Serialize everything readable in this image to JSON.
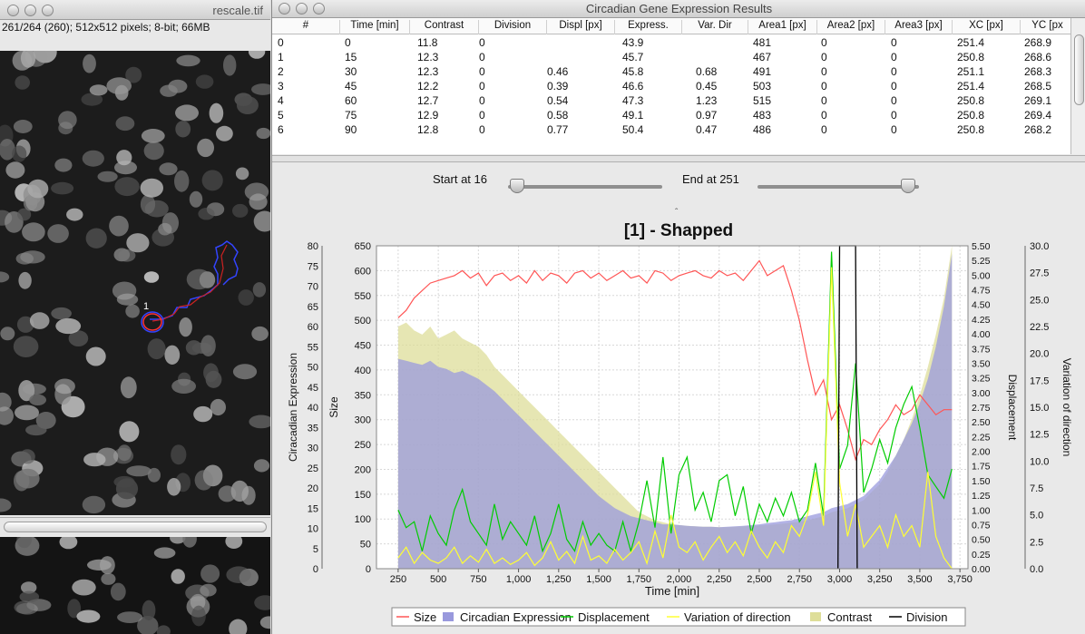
{
  "image_window": {
    "title": "rescale.tif",
    "info": "261/264 (260); 512x512 pixels; 8-bit; 66MB",
    "roi_label": "1"
  },
  "results_window": {
    "title": "Circadian Gene Expression Results"
  },
  "table": {
    "columns": [
      "#",
      "Time [min]",
      "Contrast",
      "Division",
      "Displ [px]",
      "Express.",
      "Var. Dir",
      "Area1 [px]",
      "Area2 [px]",
      "Area3 [px]",
      "XC [px]",
      "YC [px"
    ],
    "rows": [
      [
        "0",
        "0",
        "11.8",
        "0",
        "",
        "43.9",
        "",
        "481",
        "0",
        "0",
        "251.4",
        "268.9"
      ],
      [
        "1",
        "15",
        "12.3",
        "0",
        "",
        "45.7",
        "",
        "467",
        "0",
        "0",
        "250.8",
        "268.6"
      ],
      [
        "2",
        "30",
        "12.3",
        "0",
        "0.46",
        "45.8",
        "0.68",
        "491",
        "0",
        "0",
        "251.1",
        "268.3"
      ],
      [
        "3",
        "45",
        "12.2",
        "0",
        "0.39",
        "46.6",
        "0.45",
        "503",
        "0",
        "0",
        "251.4",
        "268.5"
      ],
      [
        "4",
        "60",
        "12.7",
        "0",
        "0.54",
        "47.3",
        "1.23",
        "515",
        "0",
        "0",
        "250.8",
        "269.1"
      ],
      [
        "5",
        "75",
        "12.9",
        "0",
        "0.58",
        "49.1",
        "0.97",
        "483",
        "0",
        "0",
        "250.8",
        "269.4"
      ],
      [
        "6",
        "90",
        "12.8",
        "0",
        "0.77",
        "50.4",
        "0.47",
        "486",
        "0",
        "0",
        "250.8",
        "268.2"
      ]
    ]
  },
  "controls": {
    "start_label": "Start at 16",
    "end_label": "End at 251",
    "start_slider_value": 0.06,
    "end_slider_value": 0.93
  },
  "chart_data": {
    "type": "line",
    "title": "[1] - Shapped",
    "xlabel": "Time [min]",
    "xlim": [
      115,
      3800
    ],
    "x_ticks": [
      "250",
      "500",
      "750",
      "1,000",
      "1,250",
      "1,500",
      "1,750",
      "2,000",
      "2,250",
      "2,500",
      "2,750",
      "3,000",
      "3,250",
      "3,500",
      "3,750"
    ],
    "x_tick_values": [
      250,
      500,
      750,
      1000,
      1250,
      1500,
      1750,
      2000,
      2250,
      2500,
      2750,
      3000,
      3250,
      3500,
      3750
    ],
    "axes": {
      "circadian": {
        "label": "Ciracadian Expression",
        "ylim": [
          0,
          80
        ],
        "ticks": [
          "0",
          "5",
          "10",
          "15",
          "20",
          "25",
          "30",
          "35",
          "40",
          "45",
          "50",
          "55",
          "60",
          "65",
          "70",
          "75",
          "80"
        ]
      },
      "size": {
        "label": "Size",
        "ylim": [
          0,
          650
        ],
        "ticks": [
          "0",
          "50",
          "100",
          "150",
          "200",
          "250",
          "300",
          "350",
          "400",
          "450",
          "500",
          "550",
          "600",
          "650"
        ]
      },
      "displacement": {
        "label": "Displacement",
        "ylim": [
          0,
          5.5
        ],
        "ticks": [
          "0.00",
          "0.25",
          "0.50",
          "0.75",
          "1.00",
          "1.25",
          "1.50",
          "1.75",
          "2.00",
          "2.25",
          "2.50",
          "2.75",
          "3.00",
          "3.25",
          "3.50",
          "3.75",
          "4.00",
          "4.25",
          "4.50",
          "4.75",
          "5.00",
          "5.25",
          "5.50"
        ]
      },
      "variation": {
        "label": "Variation of direction",
        "ylim": [
          0,
          30
        ],
        "ticks": [
          "0.0",
          "2.5",
          "5.0",
          "7.5",
          "10.0",
          "12.5",
          "15.0",
          "17.5",
          "20.0",
          "22.5",
          "25.0",
          "27.5",
          "30.0"
        ]
      }
    },
    "legend_position": "bottom",
    "series": [
      {
        "name": "Size",
        "color": "#ff5555",
        "axis": "size",
        "x": [
          250,
          300,
          350,
          400,
          450,
          500,
          550,
          600,
          650,
          700,
          750,
          800,
          850,
          900,
          950,
          1000,
          1050,
          1100,
          1150,
          1200,
          1250,
          1300,
          1350,
          1400,
          1450,
          1500,
          1550,
          1600,
          1650,
          1700,
          1750,
          1800,
          1850,
          1900,
          1950,
          2000,
          2050,
          2100,
          2150,
          2200,
          2250,
          2300,
          2350,
          2400,
          2450,
          2500,
          2550,
          2600,
          2650,
          2700,
          2750,
          2800,
          2850,
          2900,
          2950,
          3000,
          3050,
          3100,
          3150,
          3200,
          3250,
          3300,
          3350,
          3400,
          3450,
          3500,
          3550,
          3600,
          3650,
          3700
        ],
        "values": [
          505,
          520,
          545,
          560,
          575,
          580,
          585,
          590,
          600,
          585,
          595,
          570,
          590,
          595,
          580,
          590,
          575,
          600,
          580,
          595,
          590,
          575,
          595,
          600,
          585,
          595,
          580,
          590,
          600,
          585,
          590,
          575,
          600,
          595,
          580,
          590,
          595,
          600,
          590,
          585,
          600,
          590,
          595,
          580,
          600,
          620,
          590,
          600,
          610,
          560,
          500,
          420,
          350,
          380,
          300,
          330,
          280,
          220,
          260,
          250,
          280,
          300,
          330,
          310,
          320,
          350,
          330,
          310,
          320,
          320
        ]
      },
      {
        "name": "Circadian Expression",
        "color": "#9999dd",
        "axis": "circadian",
        "fill": true,
        "x": [
          250,
          300,
          350,
          400,
          450,
          500,
          550,
          600,
          650,
          700,
          750,
          800,
          850,
          900,
          950,
          1000,
          1050,
          1100,
          1150,
          1200,
          1250,
          1300,
          1350,
          1400,
          1450,
          1500,
          1550,
          1600,
          1650,
          1700,
          1750,
          1800,
          1850,
          1900,
          1950,
          2000,
          2050,
          2100,
          2150,
          2200,
          2250,
          2300,
          2350,
          2400,
          2450,
          2500,
          2550,
          2600,
          2650,
          2700,
          2750,
          2800,
          2850,
          2900,
          2950,
          3000,
          3050,
          3100,
          3150,
          3200,
          3250,
          3300,
          3350,
          3400,
          3450,
          3500,
          3550,
          3600,
          3650,
          3700
        ],
        "values": [
          52,
          51.5,
          51,
          50.5,
          51.5,
          50,
          49.5,
          48.5,
          49,
          48,
          47,
          45.5,
          44,
          42,
          40,
          38,
          36,
          34,
          32,
          30,
          28,
          26,
          24,
          22,
          20,
          18,
          16.5,
          15,
          14,
          13,
          12.5,
          12,
          11.5,
          11,
          11,
          10.8,
          10.6,
          10.5,
          10.4,
          10.4,
          10.3,
          10.4,
          10.5,
          10.6,
          10.8,
          11,
          11.3,
          11.5,
          11.8,
          12,
          12.5,
          13,
          13.5,
          14,
          15,
          15.5,
          16,
          17,
          18,
          20,
          22,
          25,
          28,
          32,
          36,
          41,
          47,
          55,
          65,
          78
        ]
      },
      {
        "name": "Displacement",
        "color": "#00cc00",
        "axis": "displacement",
        "x": [
          250,
          300,
          350,
          400,
          450,
          500,
          550,
          600,
          650,
          700,
          750,
          800,
          850,
          900,
          950,
          1000,
          1050,
          1100,
          1150,
          1200,
          1250,
          1300,
          1350,
          1400,
          1450,
          1500,
          1550,
          1600,
          1650,
          1700,
          1750,
          1800,
          1850,
          1900,
          1950,
          2000,
          2050,
          2100,
          2150,
          2200,
          2250,
          2300,
          2350,
          2400,
          2450,
          2500,
          2550,
          2600,
          2650,
          2700,
          2750,
          2800,
          2850,
          2900,
          2950,
          3000,
          3050,
          3100,
          3150,
          3200,
          3250,
          3300,
          3350,
          3400,
          3450,
          3500,
          3550,
          3600,
          3650,
          3700
        ],
        "values": [
          1.0,
          0.7,
          0.8,
          0.3,
          0.9,
          0.6,
          0.4,
          1.0,
          1.35,
          0.8,
          0.6,
          0.4,
          1.1,
          0.5,
          0.8,
          0.6,
          0.4,
          0.9,
          0.3,
          0.6,
          1.1,
          0.5,
          0.3,
          0.8,
          0.4,
          0.6,
          0.4,
          0.3,
          0.8,
          0.3,
          0.8,
          1.5,
          0.7,
          1.9,
          0.6,
          1.6,
          1.9,
          1.0,
          1.3,
          0.8,
          1.5,
          1.6,
          0.9,
          1.4,
          0.6,
          1.1,
          0.8,
          1.2,
          0.9,
          1.3,
          0.8,
          1.0,
          1.8,
          0.9,
          5.4,
          1.7,
          2.1,
          3.5,
          1.3,
          1.7,
          2.2,
          1.8,
          2.4,
          2.8,
          3.1,
          2.4,
          1.6,
          1.4,
          1.2,
          1.7
        ]
      },
      {
        "name": "Variation of direction",
        "color": "#ffff33",
        "axis": "variation",
        "x": [
          250,
          300,
          350,
          400,
          450,
          500,
          550,
          600,
          650,
          700,
          750,
          800,
          850,
          900,
          950,
          1000,
          1050,
          1100,
          1150,
          1200,
          1250,
          1300,
          1350,
          1400,
          1450,
          1500,
          1550,
          1600,
          1650,
          1700,
          1750,
          1800,
          1850,
          1900,
          1950,
          2000,
          2050,
          2100,
          2150,
          2200,
          2250,
          2300,
          2350,
          2400,
          2450,
          2500,
          2550,
          2600,
          2650,
          2700,
          2750,
          2800,
          2850,
          2900,
          2950,
          3000,
          3050,
          3100,
          3150,
          3200,
          3250,
          3300,
          3350,
          3400,
          3450,
          3500,
          3550,
          3600,
          3650,
          3700
        ],
        "values": [
          1,
          2,
          0.5,
          1.5,
          0.8,
          0.5,
          1,
          2,
          0.5,
          1.2,
          0.6,
          1.8,
          0.5,
          1,
          0.4,
          0.8,
          1.5,
          0.3,
          1,
          2.5,
          0.8,
          1.6,
          0.5,
          3,
          0.8,
          1.2,
          0.5,
          1.8,
          0.8,
          1.5,
          2.5,
          0.5,
          3.5,
          1,
          5,
          2,
          1.5,
          2.5,
          0.8,
          2,
          3,
          1.5,
          2.5,
          1.2,
          3.5,
          2,
          1,
          2.5,
          1.5,
          4,
          3,
          5,
          9,
          4,
          28,
          8,
          3,
          6,
          2,
          3,
          4,
          2,
          5,
          3,
          4,
          2,
          9,
          3,
          1,
          0
        ]
      },
      {
        "name": "Contrast",
        "color": "#dede99",
        "axis": "circadian",
        "fill": true,
        "x": [
          250,
          300,
          350,
          400,
          450,
          500,
          550,
          600,
          650,
          700,
          750,
          800,
          850,
          900,
          950,
          1000,
          1050,
          1100,
          1150,
          1200,
          1250,
          1300,
          1350,
          1400,
          1450,
          1500,
          1550,
          1600,
          1650,
          1700,
          1750,
          1800,
          1850,
          1900,
          1950,
          2000,
          2050,
          2100,
          2150,
          2200,
          2250,
          2300,
          2350,
          2400,
          2450,
          2500,
          2550,
          2600,
          2650,
          2700,
          2750,
          2800,
          2850,
          2900,
          2950,
          3000,
          3050,
          3100,
          3150,
          3200,
          3250,
          3300,
          3350,
          3400,
          3450,
          3500,
          3550,
          3600,
          3650,
          3700
        ],
        "values": [
          60,
          61,
          59,
          58,
          60,
          57,
          58,
          59,
          57,
          56,
          55,
          53,
          50,
          48,
          46,
          44,
          42,
          40,
          38,
          36,
          34,
          32,
          30,
          28,
          26,
          24,
          22,
          20,
          18,
          16,
          14,
          13,
          12,
          11.5,
          11,
          10.8,
          10.6,
          10.5,
          10.4,
          10.4,
          10.3,
          10.3,
          10.4,
          10.5,
          10.6,
          10.7,
          10.8,
          11,
          11.2,
          11.4,
          11.6,
          12,
          12.5,
          13,
          14,
          14.5,
          15,
          16,
          17,
          19,
          21,
          24,
          28,
          32,
          37,
          43,
          50,
          58,
          67,
          80
        ]
      },
      {
        "name": "Division",
        "color": "#000000",
        "axis": "displacement",
        "step": true,
        "x": [
          2990,
          3000,
          3100,
          3110
        ],
        "values": [
          0,
          5.5,
          5.5,
          0
        ]
      }
    ]
  }
}
